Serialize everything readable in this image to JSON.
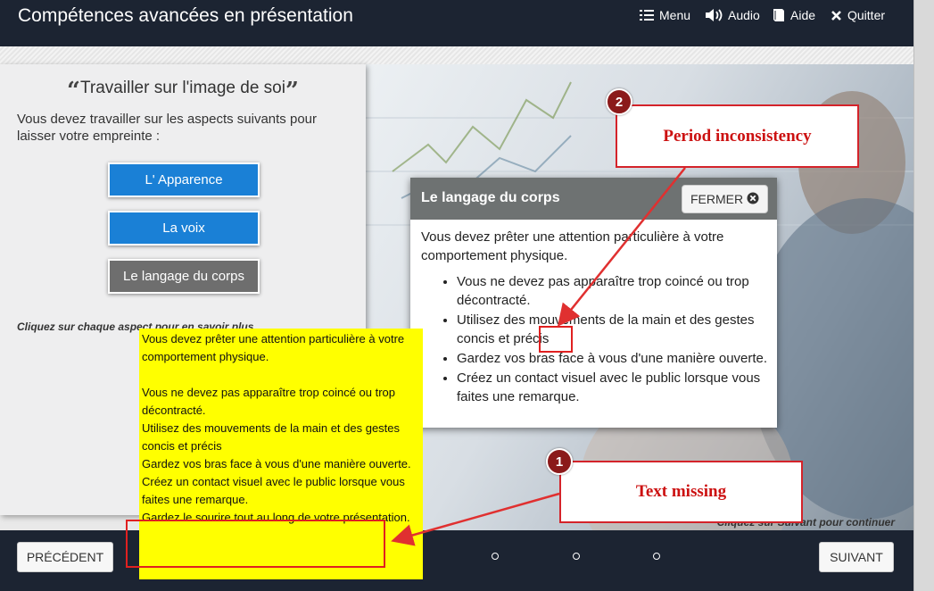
{
  "header": {
    "title": "Compétences avancées en présentation",
    "menu_label": "Menu",
    "audio_label": "Audio",
    "help_label": "Aide",
    "quit_label": "Quitter"
  },
  "left_panel": {
    "title": "Travailler sur l'image de soi",
    "quote_open": "“",
    "quote_close": "”",
    "intro": "Vous devez travailler sur les aspects suivants pour laisser votre empreinte :",
    "buttons": [
      {
        "label": "L' Apparence",
        "color": "#1a80d6"
      },
      {
        "label": "La voix",
        "color": "#1a80d6"
      },
      {
        "label": "Le langage du corps",
        "color": "#6e6e6e"
      }
    ],
    "hint": "Cliquez sur chaque aspect pour en savoir plus"
  },
  "popup": {
    "title": "Le langage du corps",
    "close_label": "FERMER",
    "intro": "Vous devez prêter une attention particulière à votre comportement physique.",
    "bullets": [
      "Vous ne devez pas apparaître trop coincé ou trop décontracté.",
      "Utilisez des mouvements de la main et des gestes concis et précis",
      "Gardez vos bras face à vous d'une manière ouverte.",
      "Créez un contact visuel avec le public lorsque vous faites une remarque."
    ]
  },
  "note": {
    "lines": [
      "Vous devez prêter une attention particulière à votre comportement physique.",
      "",
      "Vous ne devez pas apparaître trop coincé ou trop décontracté.",
      "Utilisez des mouvements de la main et des gestes concis et précis",
      "Gardez vos bras face à vous d'une manière ouverte.",
      "Créez un contact visuel avec le public lorsque vous faites une remarque.",
      "Gardez le sourire tout au long de votre présentation."
    ]
  },
  "annotations": [
    {
      "number": "1",
      "label": "Text missing"
    },
    {
      "number": "2",
      "label": "Period inconsistency"
    }
  ],
  "footer": {
    "prev_label": "PRÉCÉDENT",
    "next_label": "SUIVANT",
    "continue_hint": "Cliquez sur Suivant pour continuer"
  },
  "colors": {
    "header_bg": "#1c2432",
    "primary_button": "#1a80d6",
    "selected_button": "#6e6e6e",
    "annotation_red": "#d4232a",
    "note_yellow": "#ffff00"
  }
}
